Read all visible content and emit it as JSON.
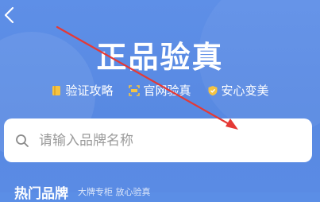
{
  "page": {
    "title": "正品验真"
  },
  "features": [
    {
      "icon": "book-icon",
      "label": "验证攻略"
    },
    {
      "icon": "scan-icon",
      "label": "官网验真"
    },
    {
      "icon": "shield-check-icon",
      "label": "安心变美"
    }
  ],
  "search": {
    "placeholder": "请输入品牌名称"
  },
  "hot": {
    "title": "热门品牌",
    "subtitle": "大牌专柜 放心验真"
  },
  "colors": {
    "background": "#5B8EE6",
    "feature_icon": "#F5C342",
    "annotation_arrow": "#E53935"
  }
}
